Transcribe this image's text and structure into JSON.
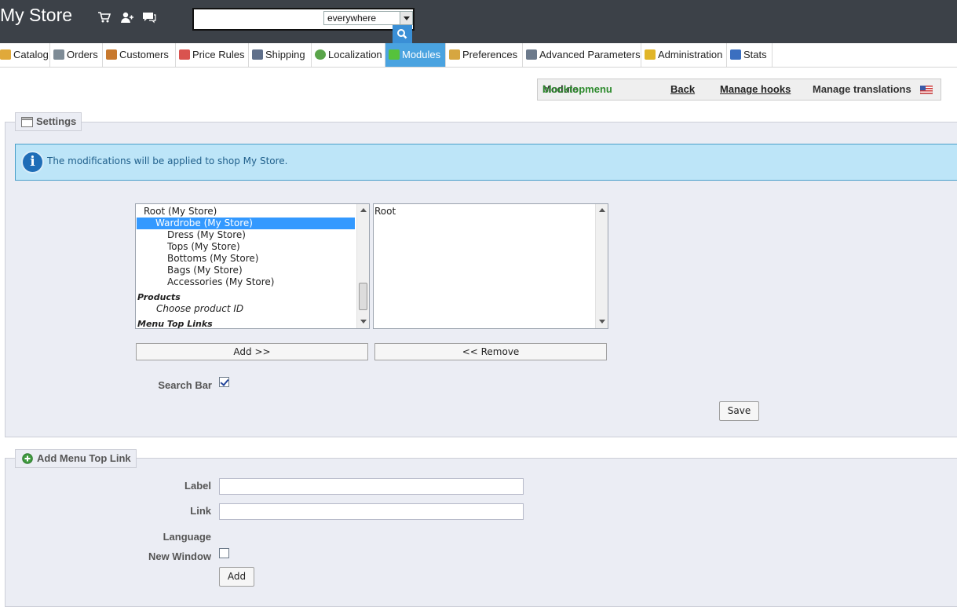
{
  "header": {
    "store_name": "My Store",
    "icons": [
      "cart-icon",
      "customer-icon",
      "messages-icon"
    ],
    "search": {
      "value": "",
      "scope": "everywhere"
    }
  },
  "nav": {
    "items": [
      {
        "label": "Catalog",
        "icon": "folder-icon",
        "color": "#e0a93a"
      },
      {
        "label": "Orders",
        "icon": "cart-icon",
        "color": "#7e8b96"
      },
      {
        "label": "Customers",
        "icon": "customer-icon",
        "color": "#c8792e"
      },
      {
        "label": "Price Rules",
        "icon": "price-tag-icon",
        "color": "#d9534f"
      },
      {
        "label": "Shipping",
        "icon": "truck-icon",
        "color": "#5f6f8a"
      },
      {
        "label": "Localization",
        "icon": "globe-icon",
        "color": "#5aa54a"
      },
      {
        "label": "Modules",
        "icon": "puzzle-icon",
        "color": "#56c23c",
        "active": true
      },
      {
        "label": "Preferences",
        "icon": "edit-icon",
        "color": "#d6a640"
      },
      {
        "label": "Advanced Parameters",
        "icon": "wrench-icon",
        "color": "#6c7a8c"
      },
      {
        "label": "Administration",
        "icon": "key-icon",
        "color": "#e1b528"
      },
      {
        "label": "Stats",
        "icon": "chart-icon",
        "color": "#3b6fc0"
      }
    ]
  },
  "toolbar": {
    "module_prefix": "Module",
    "module_name": "blocktopmenu",
    "back": "Back",
    "manage_hooks": "Manage hooks",
    "manage_translations": "Manage translations",
    "flag_icon": "us-flag-icon"
  },
  "settings": {
    "legend": "Settings",
    "info": "The modifications will be applied to shop My Store.",
    "available_items": [
      {
        "label": "Root (My Store)",
        "indent": 1
      },
      {
        "label": "Wardrobe (My Store)",
        "indent": 2,
        "selected": true
      },
      {
        "label": "Dress (My Store)",
        "indent": 3
      },
      {
        "label": "Tops (My Store)",
        "indent": 3
      },
      {
        "label": "Bottoms (My Store)",
        "indent": 3
      },
      {
        "label": "Bags (My Store)",
        "indent": 3
      },
      {
        "label": "Accessories (My Store)",
        "indent": 3
      }
    ],
    "group_products": "Products",
    "choose_product": "Choose product ID",
    "group_menu_links": "Menu Top Links",
    "selected_items": [
      "Root"
    ],
    "add_button": "Add >>",
    "remove_button": "<< Remove",
    "search_bar_label": "Search Bar",
    "search_bar_checked": true,
    "save_button": "Save"
  },
  "add_link": {
    "legend": "Add Menu Top Link",
    "label_label": "Label",
    "label_value": "",
    "link_label": "Link",
    "link_value": "",
    "language_label": "Language",
    "new_window_label": "New Window",
    "new_window_checked": false,
    "add_button": "Add"
  }
}
